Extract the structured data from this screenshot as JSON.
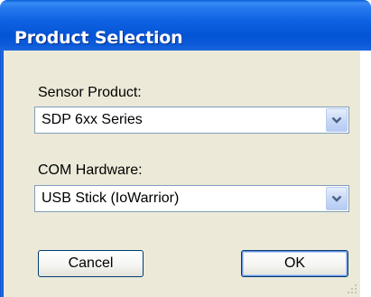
{
  "window": {
    "title": "Product Selection"
  },
  "sensor_product": {
    "label": "Sensor Product:",
    "selected": "SDP 6xx Series",
    "dropdown_icon": "chevron-down-icon"
  },
  "com_hardware": {
    "label": "COM Hardware:",
    "selected": "USB Stick (IoWarrior)",
    "dropdown_icon": "chevron-down-icon"
  },
  "buttons": {
    "cancel_label": "Cancel",
    "ok_label": "OK"
  },
  "colors": {
    "titlebar": "#0554d6",
    "dialog_face": "#ece9d8",
    "combo_border": "#7f9db9",
    "button_border": "#003c74"
  }
}
